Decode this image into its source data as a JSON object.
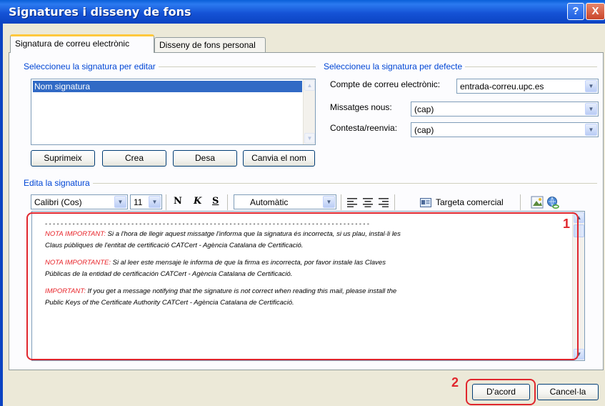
{
  "window": {
    "title": "Signatures i disseny de fons",
    "help_glyph": "?",
    "close_glyph": "X"
  },
  "tabs": [
    {
      "label": "Signatura de correu electrònic"
    },
    {
      "label": "Disseny de fons personal"
    }
  ],
  "edit_section": {
    "label": "Seleccioneu la signatura per editar",
    "signatures": [
      "Nom signatura"
    ],
    "buttons": {
      "delete": "Suprimeix",
      "new": "Crea",
      "save": "Desa",
      "rename": "Canvia el nom"
    }
  },
  "default_section": {
    "label": "Seleccioneu la signatura per defecte",
    "account_label": "Compte de correu electrònic:",
    "account_value": "entrada-correu.upc.es",
    "new_messages_label": "Missatges nous:",
    "new_messages_value": "(cap)",
    "replies_label": "Contesta/reenvia:",
    "replies_value": "(cap)"
  },
  "editor": {
    "label": "Edita la signatura",
    "font": "Calibri (Cos)",
    "size": "11",
    "bold": "N",
    "italic": "K",
    "underline": "S",
    "color": "Automàtic",
    "business_card": "Targeta comercial",
    "dashes": "- - - - - - - - - - - - - - - - - - - - - - - - - - - - - - - - - - - - - - - - - - - - - - - - - - - - - - - - - - - - - - - - - - - - - - - - - - - - - - - - - - -",
    "paragraphs": [
      {
        "label": "NOTA IMPORTANT:",
        "text": " Si a l'hora de llegir aquest missatge l'informa que la signatura és incorrecta, si us plau, instal·li les  Claus públiques  de l'entitat de certificació CATCert - Agència Catalana de Certificació."
      },
      {
        "label": "NOTA IMPORTANTE:",
        "text": " Si al leer este mensaje le informa  de que la firma es incorrecta, por favor instale las  Claves Públicas de la entidad de certificación CATCert - Agència Catalana de Certificació."
      },
      {
        "label": "IMPORTANT:",
        "text": "  If you get a message notifying that the signature is not correct when reading this mail, please install the  Public Keys of the Certificate Authority CATCert - Agència Catalana de Certificació."
      }
    ]
  },
  "annotations": {
    "editor_number": "1",
    "ok_number": "2",
    "color": "#E0262D"
  },
  "footer": {
    "ok": "D'acord",
    "cancel": "Cancel·la"
  },
  "colors": {
    "title_bar": "#0B43C2",
    "dialog_bg": "#ECE9D8",
    "group_label": "#0046D5",
    "selection": "#316AC5"
  }
}
